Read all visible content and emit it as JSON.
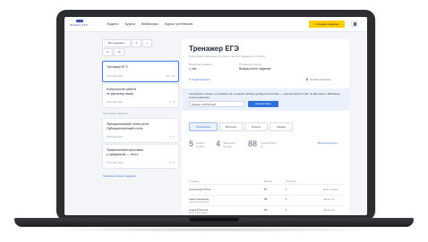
{
  "topbar": {
    "logo_text": "ЯКЛАСС ЕГЭ",
    "nav": [
      "Задачи",
      "Курсы",
      "Вебинары",
      "Курсы учебников"
    ],
    "cta_label": "+ Создать задание"
  },
  "sidebar": {
    "filter_all": "Все задания",
    "filter_sort": "≡",
    "filter_plus": "+",
    "filter_a": "Ч",
    "filter_b": "Чк",
    "cards": [
      {
        "title": "Тренажер ЕГЭ",
        "sub": "Русский язык",
        "num": "10 / 24"
      },
      {
        "title": "Контрольная работа",
        "title2": "по русскому языку",
        "sub": "Русский язык",
        "num": "1 / 8"
      }
    ],
    "section_label": "Последние задания",
    "cards2": [
      {
        "title": "Функциональные стиля речи.",
        "title2": "Публицистический стиль",
        "sub": "Русский язык",
        "num": "1 / 3"
      },
      {
        "title": "Правописание приставок",
        "title2": "и суффиксов — тесть",
        "sub": "Русский язык",
        "num": "1 / 6"
      }
    ],
    "show_more": "Показать больше заданий"
  },
  "main": {
    "title": "Тренажер ЕГЭ",
    "desc": "Подготовка к экзамену для всех классов. Задания по теории",
    "meta": [
      {
        "k": "Время на задания",
        "v": "1 час"
      },
      {
        "k": "Проверка ответов",
        "v": "Вывод после задания"
      }
    ],
    "edit_link": "✎ Редактировать",
    "delete_link": "🗑 Удалить задание",
    "share_text": "Скопируйте ссылку и отправьте её ученикам любым удобным способом — электронной почтой, по Вконтакте, WhatsApp, в мессенджерах.",
    "share_input": "yaklass.ru/t/7k3ma9",
    "share_btn": "Скопировать",
    "tabs": [
      "Результаты",
      "Вопросы",
      "Ответы",
      "Сводка"
    ],
    "stats": [
      {
        "num": "5",
        "label": "Начали решать"
      },
      {
        "num": "4",
        "label": "Закончили решать"
      },
      {
        "num": "88",
        "label": "Средний балл, %"
      }
    ],
    "stats_link": "Все результаты",
    "table_headers": [
      "Ученики",
      "Баллы",
      "Попытки",
      ""
    ],
    "rows": [
      {
        "name": "Александр Попов",
        "sub": "",
        "score": "50",
        "tries": "1",
        "status": "Еще решает"
      },
      {
        "name": "Анна Смирнова",
        "sub": "Сдала 4 мин назад",
        "score": "98",
        "tries": "1",
        "status": "Закончил"
      },
      {
        "name": "Андрей Петров",
        "sub": "Сдал 8 мин назад",
        "score": "90",
        "tries": "1",
        "status": "Закончил"
      }
    ]
  }
}
